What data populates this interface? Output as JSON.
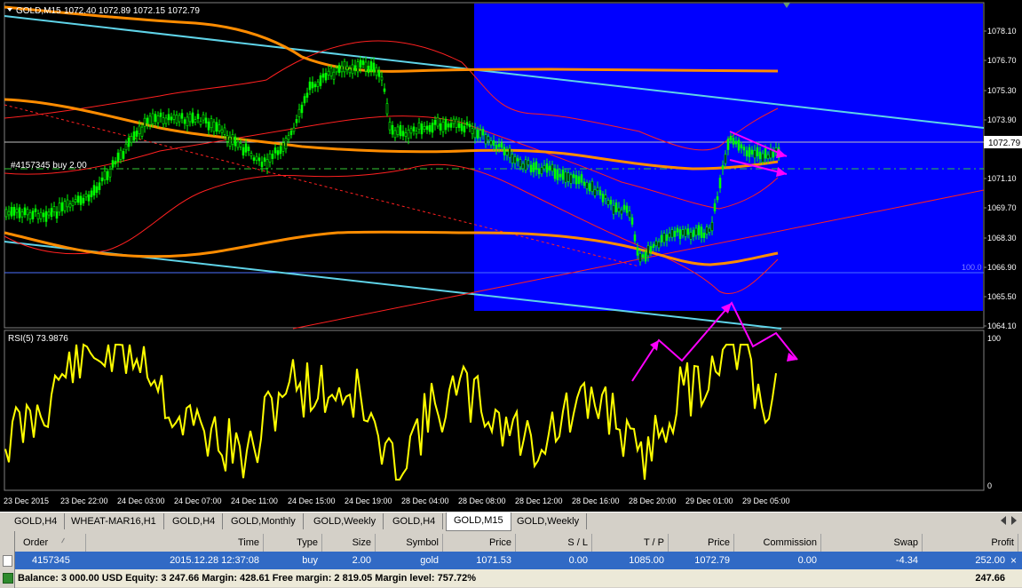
{
  "symbol_header": {
    "name": "GOLD,M15",
    "ohlc": "1072.40 1072.89 1072.15 1072.79"
  },
  "indicator_label": "RSI(5) 73.9876",
  "order_line_label": "#4157345 buy 2.00",
  "level_label": "100.0",
  "price_current": "1072.79",
  "price_axis": [
    "1078.10",
    "1076.70",
    "1075.30",
    "1073.90",
    "1071.10",
    "1069.70",
    "1068.30",
    "1066.90",
    "1065.50",
    "1064.10"
  ],
  "rsi_axis": [
    "100",
    "0"
  ],
  "time_axis": [
    "23 Dec 2015",
    "23 Dec 22:00",
    "24 Dec 03:00",
    "24 Dec 07:00",
    "24 Dec 11:00",
    "24 Dec 15:00",
    "24 Dec 19:00",
    "28 Dec 04:00",
    "28 Dec 08:00",
    "28 Dec 12:00",
    "28 Dec 16:00",
    "28 Dec 20:00",
    "29 Dec 01:00",
    "29 Dec 05:00"
  ],
  "tabs": [
    "GOLD,H4",
    "WHEAT-MAR16,H1",
    "GOLD,H4",
    "GOLD,Monthly",
    "GOLD,Weekly",
    "GOLD,H4",
    "GOLD,M15",
    "GOLD,Weekly"
  ],
  "active_tab": "GOLD,M15",
  "table": {
    "headers": [
      "Order",
      "Time",
      "Type",
      "Size",
      "Symbol",
      "Price",
      "S / L",
      "T / P",
      "Price",
      "Commission",
      "Swap",
      "Profit"
    ],
    "order_row": [
      "4157345",
      "2015.12.28 12:37:08",
      "buy",
      "2.00",
      "gold",
      "1071.53",
      "0.00",
      "1085.00",
      "1072.79",
      "0.00",
      "-4.34",
      "252.00"
    ],
    "balance_line": "Balance: 3 000.00 USD  Equity: 3 247.66  Margin: 428.61  Free margin: 2 819.05  Margin level: 757.72%",
    "balance_profit": "247.66"
  },
  "colors": {
    "up_candle": "#00ff00",
    "highlight_box": "#0000ff",
    "rsi_line": "#ffff00",
    "annotation": "#ff00ff",
    "moving_average": "#ff8c00",
    "bollinger": "#ff2020",
    "trend_channel": "#5fd3e8"
  }
}
